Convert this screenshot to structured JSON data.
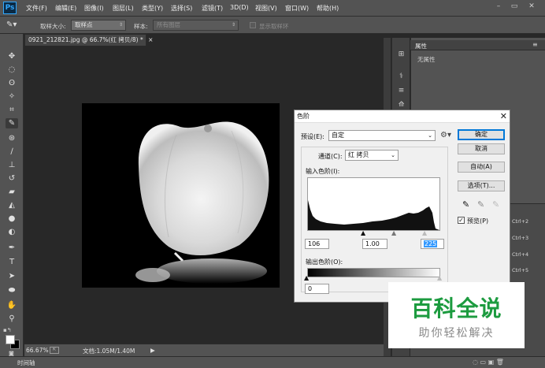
{
  "app": {
    "logo": "Ps"
  },
  "menu": [
    "文件(F)",
    "编辑(E)",
    "图像(I)",
    "图层(L)",
    "类型(Y)",
    "选择(S)",
    "滤镜(T)",
    "3D(D)",
    "视图(V)",
    "窗口(W)",
    "帮助(H)"
  ],
  "window_controls": {
    "minimize": "–",
    "restore": "▭",
    "close": "✕"
  },
  "options_bar": {
    "sample_size_label": "取样大小:",
    "sample_size_value": "取样点",
    "sample_label": "样本:",
    "sample_value": "所有图层",
    "show_ring_label": "显示取样环"
  },
  "document_tab": {
    "title": "0921_212821.jpg @ 66.7%(红 拷贝/8) *",
    "close": "×"
  },
  "status": {
    "zoom": "66.67%",
    "doc_size": "文档:1.05M/1.40M"
  },
  "timeline": {
    "label": "时间轴"
  },
  "properties_panel": {
    "tab": "属性",
    "content": "无属性"
  },
  "shortcuts": [
    "Ctrl+2",
    "Ctrl+3",
    "Ctrl+4",
    "Ctrl+5"
  ],
  "tools": [
    "move-tool-icon",
    "marquee-tool-icon",
    "lasso-tool-icon",
    "magic-wand-icon",
    "crop-tool-icon",
    "eyedropper-tool-icon",
    "healing-brush-icon",
    "brush-tool-icon",
    "clone-stamp-icon",
    "history-brush-icon",
    "eraser-tool-icon",
    "paint-bucket-icon",
    "blur-tool-icon",
    "dodge-tool-icon",
    "pen-tool-icon",
    "type-tool-icon",
    "path-select-icon",
    "ellipse-tool-icon",
    "hand-tool-icon",
    "zoom-tool-icon"
  ],
  "levels_dialog": {
    "title": "色阶",
    "close": "✕",
    "preset_label": "预设(E):",
    "preset_value": "自定",
    "channel_label": "通道(C):",
    "channel_value": "红 拷贝",
    "input_levels_label": "输入色阶(I):",
    "input_black": "106",
    "input_gamma": "1.00",
    "input_white": "225",
    "output_levels_label": "输出色阶(O):",
    "output_black": "0",
    "buttons": {
      "ok": "确定",
      "cancel": "取消",
      "auto": "自动(A)",
      "options": "选项(T)..."
    },
    "preview_label": "预览(P)",
    "preview_checked": true
  },
  "watermark": {
    "title": "百科全说",
    "subtitle": "助你轻松解决"
  }
}
